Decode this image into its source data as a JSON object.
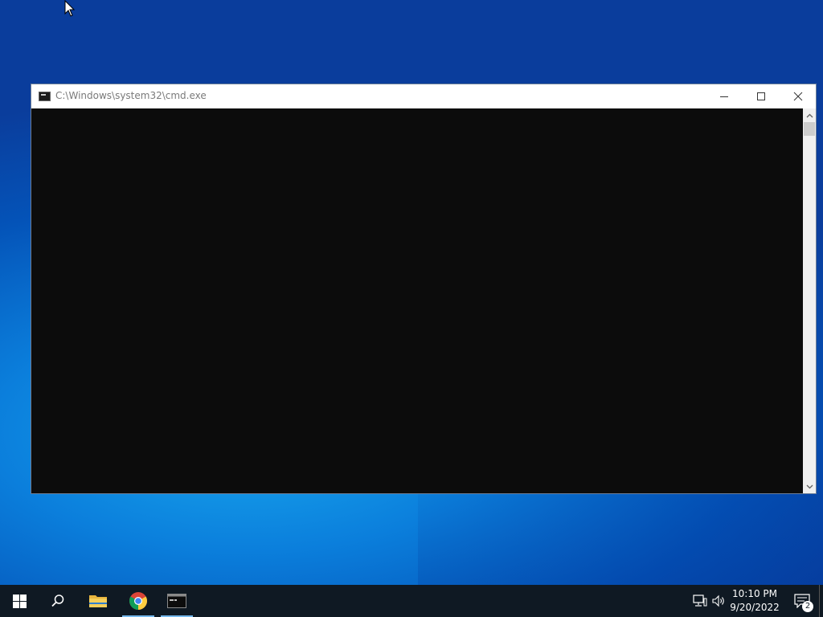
{
  "window": {
    "title": "C:\\Windows\\system32\\cmd.exe",
    "icon": "console-icon"
  },
  "taskbar": {
    "items": [
      {
        "name": "start-button",
        "icon": "windows-logo-icon"
      },
      {
        "name": "search-button",
        "icon": "search-icon"
      },
      {
        "name": "file-explorer",
        "icon": "folder-icon"
      },
      {
        "name": "chrome",
        "icon": "chrome-icon",
        "active": true
      },
      {
        "name": "command-prompt",
        "icon": "console-icon",
        "active": true
      }
    ],
    "tray": {
      "network_icon": "network-icon",
      "volume_icon": "volume-icon",
      "time": "10:10 PM",
      "date": "9/20/2022",
      "notification_count": "2"
    }
  },
  "colors": {
    "console_bg": "#0c0c0c",
    "taskbar_bg": "#0f1923",
    "accent": "#76b9ed"
  }
}
